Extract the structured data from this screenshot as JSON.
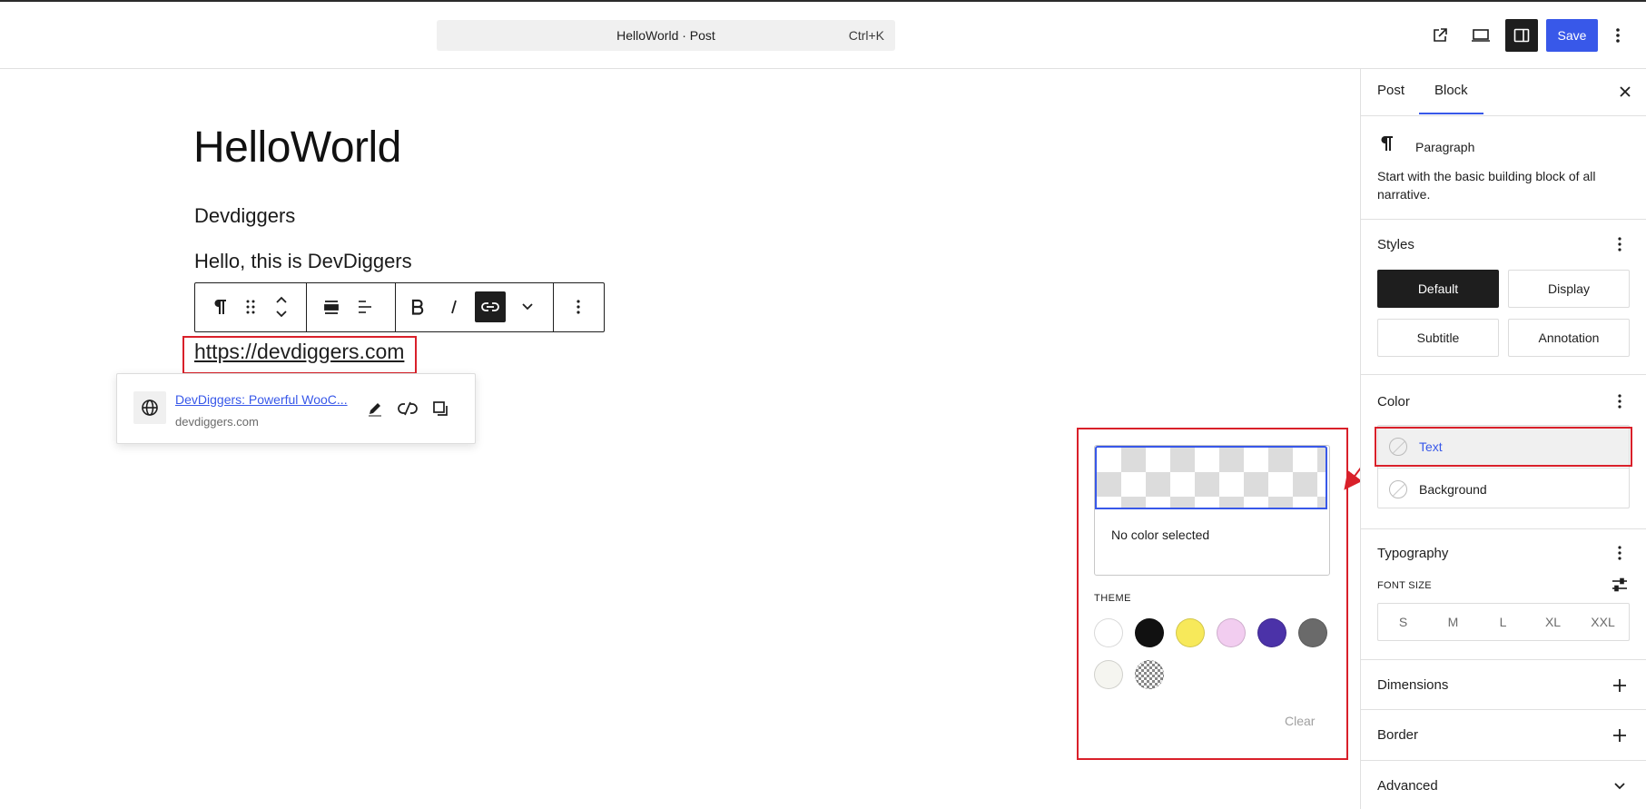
{
  "header": {
    "command_title": "HelloWorld · Post",
    "command_shortcut": "Ctrl+K",
    "save_label": "Save",
    "icons": [
      "external-link-icon",
      "desktop-preview-icon",
      "settings-sidebar-icon",
      "more-vertical-icon"
    ]
  },
  "editor": {
    "title": "HelloWorld",
    "paragraphs": [
      "Devdiggers",
      "Hello, this is DevDiggers"
    ],
    "link_text": "https://devdiggers.com",
    "toolbar_icons": [
      "paragraph-icon",
      "drag-handle-icon",
      "move-up-down-icon",
      "align-wide-icon",
      "align-left-icon",
      "bold-icon",
      "italic-icon",
      "link-icon",
      "chevron-down-icon",
      "more-options-icon"
    ],
    "link_preview": {
      "title": "DevDiggers: Powerful WooC...",
      "url": "devdiggers.com"
    }
  },
  "color_picker": {
    "status": "No color selected",
    "theme_label": "THEME",
    "swatches": [
      "#ffffff",
      "#111111",
      "#f7e95a",
      "#f2cdf0",
      "#4b32a8",
      "#6a6a6a",
      "#f5f5f0",
      "transparent"
    ],
    "clear_label": "Clear"
  },
  "sidebar": {
    "tabs": [
      "Post",
      "Block"
    ],
    "active_tab": "Block",
    "block": {
      "name": "Paragraph",
      "description": "Start with the basic building block of all narrative."
    },
    "styles": {
      "title": "Styles",
      "options": [
        "Default",
        "Display",
        "Subtitle",
        "Annotation"
      ],
      "selected": "Default"
    },
    "color": {
      "title": "Color",
      "items": [
        "Text",
        "Background"
      ],
      "selected": "Text"
    },
    "typography": {
      "title": "Typography",
      "font_size_label": "FONT SIZE",
      "sizes": [
        "S",
        "M",
        "L",
        "XL",
        "XXL"
      ]
    },
    "dimensions": {
      "title": "Dimensions"
    },
    "border": {
      "title": "Border"
    },
    "advanced": {
      "title": "Advanced"
    }
  },
  "colors": {
    "accent": "#3858e9",
    "highlight_red": "#d9202a",
    "text": "#1e1e1e"
  }
}
